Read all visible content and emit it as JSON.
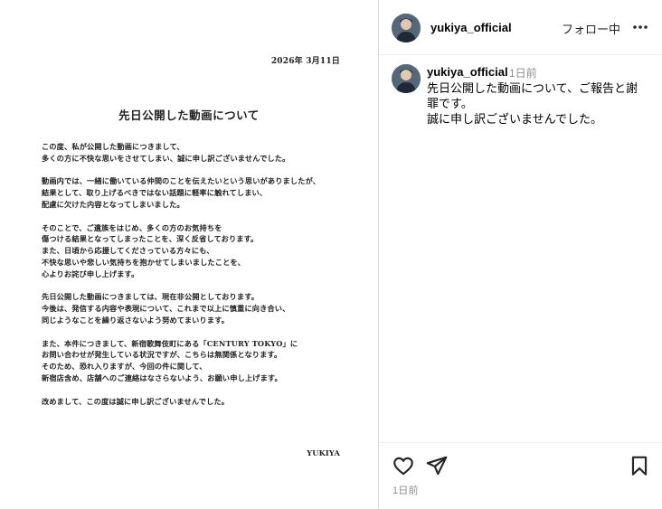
{
  "letter": {
    "date": "2026年 3月11日",
    "heading": "先日公開した動画について",
    "paragraphs": [
      [
        "この度、私が公開した動画につきまして、",
        "多くの方に不快な思いをさせてしまい、誠に申し訳ございませんでした。"
      ],
      [
        "動画内では、一緒に働いている仲間のことを伝えたいという思いがありましたが、",
        "結果として、取り上げるべきではない話題に軽率に触れてしまい、",
        "配慮に欠けた内容となってしまいました。"
      ],
      [
        "そのことで、ご遺族をはじめ、多くの方のお気持ちを",
        "傷つける結果となってしまったことを、深く反省しております。",
        "また、日頃から応援してくださっている方々にも、",
        "不快な思いや悲しい気持ちを抱かせてしまいましたことを、",
        "心よりお詫び申し上げます。"
      ],
      [
        "先日公開した動画につきましては、現在非公開としております。",
        "今後は、発信する内容や表現について、これまで以上に慎重に向き合い、",
        "同じようなことを繰り返さないよう努めてまいります。"
      ],
      [
        "また、本件につきまして、新宿歌舞伎町にある「CENTURY TOKYO」に",
        "お問い合わせが発生している状況ですが、こちらは無関係となります。",
        "そのため、恐れ入りますが、今回の件に関して、",
        "新宿店含め、店舗へのご連絡はなさらないよう、お願い申し上げます。"
      ],
      [
        "改めまして、この度は誠に申し訳ございませんでした。"
      ]
    ],
    "signature": "YUKIYA"
  },
  "header": {
    "username": "yukiya_official",
    "follow_label": "フォロー中",
    "more_icon": "more-horizontal-icon"
  },
  "caption": {
    "username": "yukiya_official",
    "time": "1日前",
    "lines": [
      "先日公開した動画について、ご報告と謝",
      "罪です。",
      "誠に申し訳ございませんでした。"
    ]
  },
  "actions": {
    "like_icon": "heart-icon",
    "share_icon": "paper-plane-icon",
    "save_icon": "bookmark-icon"
  },
  "post_time": "1日前",
  "colors": {
    "divider": "#dbdbdb",
    "muted_text": "#8e8e8e",
    "avatar_bg": "#6b7c8c"
  }
}
